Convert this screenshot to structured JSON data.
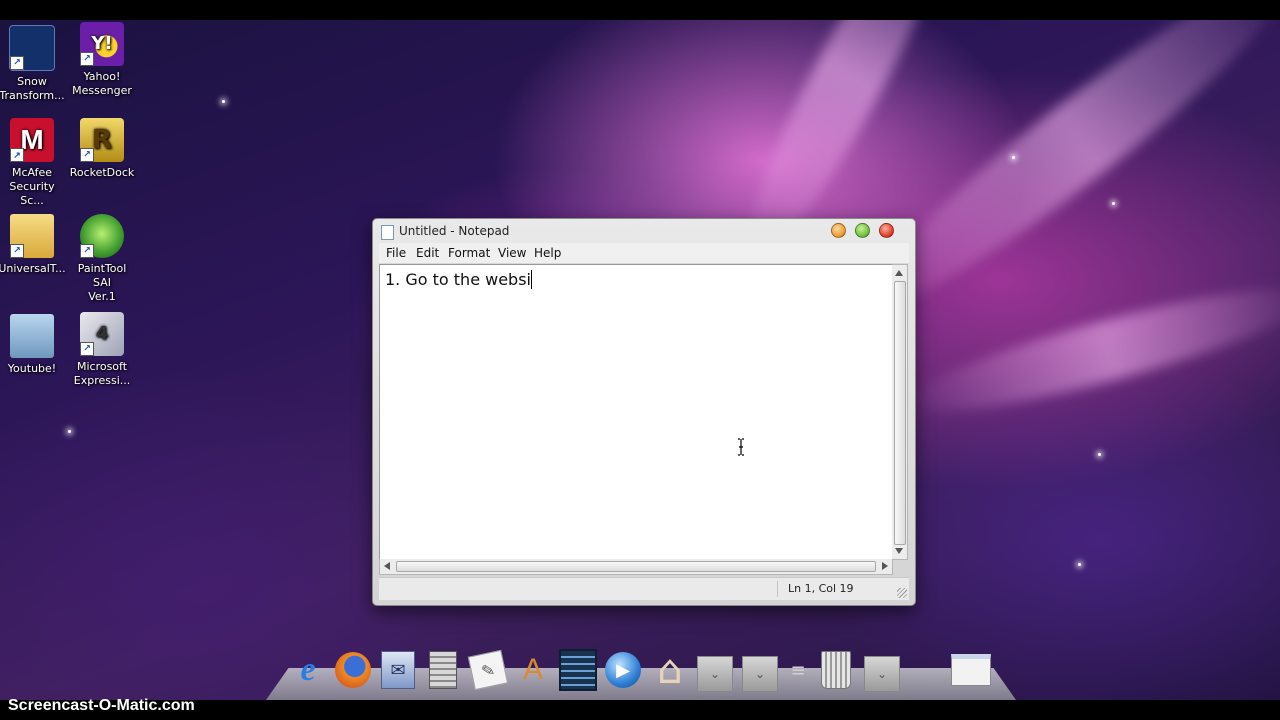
{
  "desktop": {
    "icons": [
      {
        "label_line1": "Snow",
        "label_line2": "Transform...",
        "icon": "snow-transformer-icon",
        "color": "#14306a"
      },
      {
        "label_line1": "Yahoo!",
        "label_line2": "Messenger",
        "icon": "yahoo-messenger-icon",
        "color": "#6b1fa8"
      },
      {
        "label_line1": "McAfee",
        "label_line2": "Security Sc...",
        "icon": "mcafee-icon",
        "color": "#c8102e"
      },
      {
        "label_line1": "RocketDock",
        "label_line2": "",
        "icon": "rocketdock-icon",
        "color": "#d9b52a"
      },
      {
        "label_line1": "UniversalT...",
        "label_line2": "",
        "icon": "folder-icon",
        "color": "#e8c55a"
      },
      {
        "label_line1": "PaintTool SAI",
        "label_line2": "Ver.1",
        "icon": "painttool-sai-icon",
        "color": "#4cae3c"
      },
      {
        "label_line1": "Youtube!",
        "label_line2": "",
        "icon": "folder-icon",
        "color": "#8fb8d8"
      },
      {
        "label_line1": "Microsoft",
        "label_line2": "Expressi...",
        "icon": "microsoft-expression-icon",
        "color": "#c03030"
      }
    ]
  },
  "notepad": {
    "title": "Untitled - Notepad",
    "menu": [
      "File",
      "Edit",
      "Format",
      "View",
      "Help"
    ],
    "content": "1. Go to the websi",
    "status": "Ln 1, Col 19",
    "buttons": {
      "minimize": "minimize",
      "maximize": "maximize",
      "close": "close"
    }
  },
  "dock": {
    "items": [
      {
        "name": "internet-explorer-icon",
        "glyph": "e",
        "color": "#2a7de0"
      },
      {
        "name": "firefox-icon",
        "glyph": "◉",
        "color": "#e86a1e"
      },
      {
        "name": "mail-icon",
        "glyph": "✉",
        "color": "#3f67b0"
      },
      {
        "name": "calculator-icon",
        "glyph": "▦",
        "color": "#777777"
      },
      {
        "name": "notes-icon",
        "glyph": "✎",
        "color": "#bbbbbb"
      },
      {
        "name": "applications-icon",
        "glyph": "A",
        "color": "#d98a2e"
      },
      {
        "name": "film-icon",
        "glyph": "▤",
        "color": "#2d5d8a"
      },
      {
        "name": "media-player-icon",
        "glyph": "▶",
        "color": "#2d7fd6"
      },
      {
        "name": "home-icon",
        "glyph": "⌂",
        "color": "#c9a27a"
      },
      {
        "name": "stack-1-icon",
        "glyph": "⌄",
        "color": "#999999"
      },
      {
        "name": "stack-2-icon",
        "glyph": "⌄",
        "color": "#999999"
      },
      {
        "name": "separator-icon",
        "glyph": "≡",
        "color": "#aaaaaa"
      },
      {
        "name": "trash-icon",
        "glyph": "🗑",
        "color": "#cccccc"
      },
      {
        "name": "stack-3-icon",
        "glyph": "⌄",
        "color": "#999999"
      },
      {
        "name": "window-thumbnail-icon",
        "glyph": "▭",
        "color": "#dddddd"
      }
    ]
  },
  "watermark": "Screencast-O-Matic.com"
}
